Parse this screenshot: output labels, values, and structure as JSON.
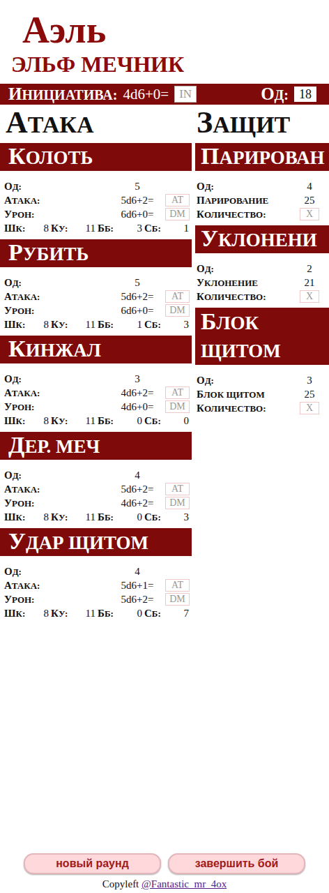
{
  "title": "Аэль",
  "subtitle": "ЭЛЬФ МЕЧНИК",
  "initiative": {
    "label": "ИНИЦИАТИВА:",
    "formula": "4d6+0=",
    "input": "IN"
  },
  "action_points": {
    "label": "ОД:",
    "value": "18"
  },
  "attack_heading": "АТАКА",
  "defense_heading": "ЗАЩИТ",
  "labels": {
    "od": "ОД:",
    "attack": "АТАКА:",
    "damage": "УРОН:",
    "shk": "ШК:",
    "ku": "КУ:",
    "bb": "ББ:",
    "sb": "СБ:",
    "count": "КОЛИЧЕСТВО:"
  },
  "attacks": [
    {
      "name": "КОЛОТЬ",
      "od": "5",
      "attack": "5d6+2=",
      "attack_input": "AT",
      "damage": "6d6+0=",
      "damage_input": "DM",
      "shk": "8",
      "ku": "11",
      "bb": "3",
      "sb": "1"
    },
    {
      "name": "РУБИТЬ",
      "od": "5",
      "attack": "5d6+2=",
      "attack_input": "AT",
      "damage": "6d6+0=",
      "damage_input": "DM",
      "shk": "8",
      "ku": "11",
      "bb": "1",
      "sb": "3"
    },
    {
      "name": "КИНЖАЛ",
      "od": "3",
      "attack": "4d6+2=",
      "attack_input": "AT",
      "damage": "4d6+0=",
      "damage_input": "DM",
      "shk": "8",
      "ku": "11",
      "bb": "0",
      "sb": "0"
    },
    {
      "name": "ДЕР. МЕЧ",
      "od": "4",
      "attack": "5d6+2=",
      "attack_input": "AT",
      "damage": "4d6+2=",
      "damage_input": "DM",
      "shk": "8",
      "ku": "11",
      "bb": "0",
      "sb": "3"
    },
    {
      "name": "УДАР ЩИТОМ",
      "od": "4",
      "attack": "5d6+1=",
      "attack_input": "AT",
      "damage": "5d6+2=",
      "damage_input": "DM",
      "shk": "8",
      "ku": "11",
      "bb": "0",
      "sb": "7"
    }
  ],
  "defenses": [
    {
      "name": "ПАРИРОВАН",
      "od": "4",
      "stat_label": "ПАРИРОВАНИЕ",
      "stat": "25",
      "count_input": "X"
    },
    {
      "name": "УКЛОНЕНИ",
      "od": "2",
      "stat_label": "УКЛОНЕНИЕ",
      "stat": "21",
      "count_input": "X"
    },
    {
      "name": "БЛОК ЩИТОМ",
      "od": "3",
      "stat_label": "БЛОК ЩИТОМ",
      "stat": "25",
      "count_input": "X"
    }
  ],
  "buttons": [
    "новый раунд",
    "завершить бой"
  ],
  "footer": {
    "prefix": "Copyleft",
    "link": "@Fantastic_mr_4ox"
  }
}
